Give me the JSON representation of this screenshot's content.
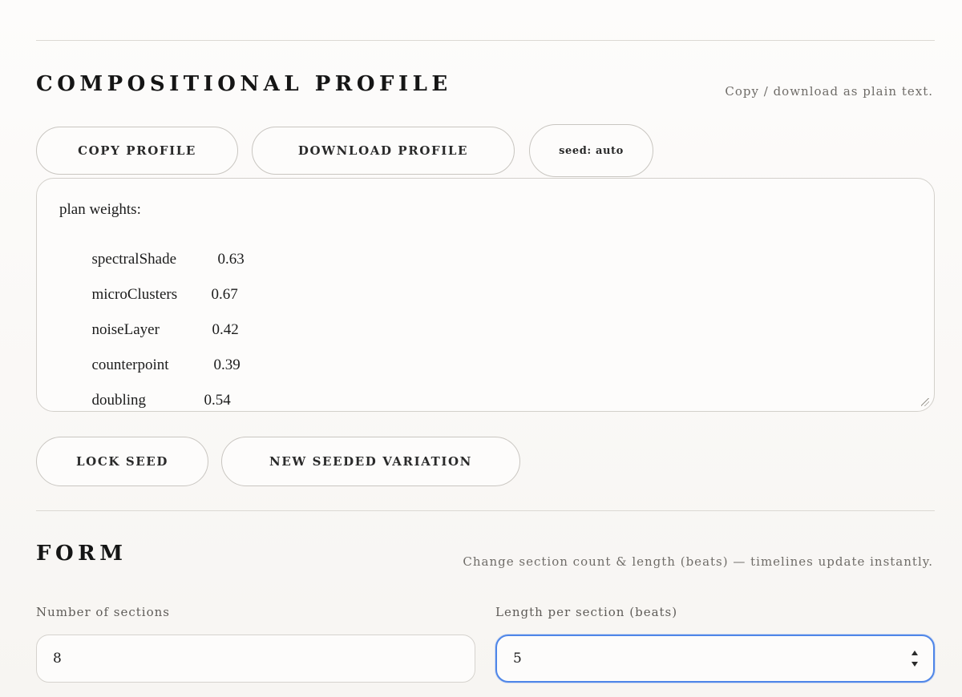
{
  "profile": {
    "title": "COMPOSITIONAL PROFILE",
    "note": "Copy / download as plain text.",
    "buttons": {
      "copy": "COPY PROFILE",
      "download": "DOWNLOAD PROFILE",
      "seed": "seed: auto"
    },
    "heading": "plan weights:",
    "weights": [
      {
        "key": "spectralShade",
        "value": "0.63"
      },
      {
        "key": "microClusters",
        "value": "0.67"
      },
      {
        "key": "noiseLayer",
        "value": "0.42"
      },
      {
        "key": "counterpoint",
        "value": "0.39"
      },
      {
        "key": "doubling",
        "value": "0.54"
      }
    ],
    "actions": {
      "lock_seed": "LOCK SEED",
      "new_variation": "NEW SEEDED VARIATION"
    }
  },
  "form": {
    "title": "FORM",
    "note": "Change section count & length (beats) — timelines update instantly.",
    "sections_label": "Number of sections",
    "sections_value": "8",
    "length_label": "Length per section (beats)",
    "length_value": "5"
  },
  "colors": {
    "focus_ring": "#4f86e8",
    "border": "#c9c6c1",
    "text": "#1d1d1d",
    "muted": "#6f6c68"
  }
}
